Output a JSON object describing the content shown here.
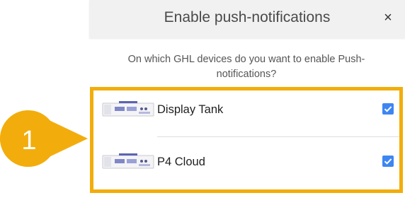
{
  "dialog": {
    "title": "Enable push-notifications",
    "close_glyph": "×",
    "question": "On which GHL devices do you want to enable Push-notifications?"
  },
  "devices": [
    {
      "name": "Display Tank",
      "checked": true,
      "icon": "controller-device-icon"
    },
    {
      "name": "P4 Cloud",
      "checked": true,
      "icon": "controller-device-icon"
    }
  ],
  "callout": {
    "number": "1",
    "color": "#f2ad0c"
  },
  "colors": {
    "accent": "#f2ad0c",
    "checkbox": "#3d86f2",
    "header_bg": "#f1f1f1"
  }
}
